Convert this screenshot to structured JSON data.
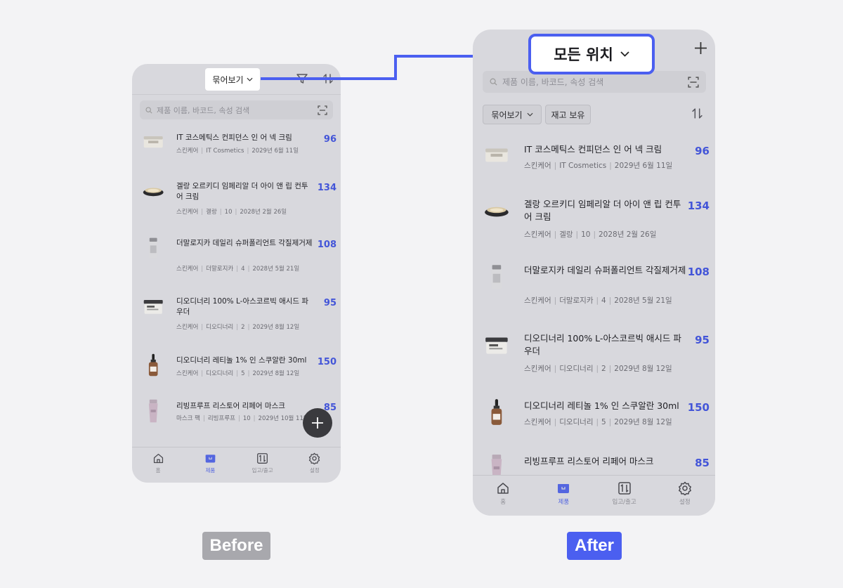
{
  "colors": {
    "accent": "#5466e0",
    "qty": "#4355d8",
    "phone_bg": "#d8d8dd",
    "page_bg": "#f3f3f5",
    "arrow": "#4b5ff0"
  },
  "before": {
    "caption": "Before",
    "group_view_label": "묶어보기",
    "search_placeholder": "제품 이름, 바코드, 속성 검색",
    "fab_icon": "plus-icon",
    "products": [
      {
        "name": "IT 코스메틱스 컨피던스 인 어 넥 크림",
        "meta": [
          "스킨케어",
          "IT Cosmetics",
          "2029년 6월 11일"
        ],
        "qty": "96",
        "thumb": "jar-white"
      },
      {
        "name": "겔랑 오르키디 임페리알 더 아이 앤 립 컨투어 크림",
        "meta": [
          "스킨케어",
          "겔랑",
          "10",
          "2028년 2월 26일"
        ],
        "qty": "134",
        "thumb": "jar-black"
      },
      {
        "name": "더말로지카 데일리 슈퍼폴리언트 각질제거제",
        "meta": [
          "스킨케어",
          "더말로지카",
          "4",
          "2028년 5월 21일"
        ],
        "qty": "108",
        "thumb": "bottle-silver"
      },
      {
        "name": "디오디너리 100% L-아스코르빅 애시드 파우더",
        "meta": [
          "스킨케어",
          "디오디너리",
          "2",
          "2029년 8월 12일"
        ],
        "qty": "95",
        "thumb": "jar-wide"
      },
      {
        "name": "디오디너리 레티놀 1% 인 스쿠알란 30ml",
        "meta": [
          "스킨케어",
          "디오디너리",
          "5",
          "2029년 8월 12일"
        ],
        "qty": "150",
        "thumb": "dropper"
      },
      {
        "name": "리빙프루프 리스토어 리페어 마스크",
        "meta": [
          "마스크 팩",
          "리빙프루프",
          "10",
          "2029년 10월 11일"
        ],
        "qty": "85",
        "thumb": "tube"
      }
    ],
    "tabs": [
      {
        "label": "홈",
        "icon": "home-icon"
      },
      {
        "label": "제품",
        "icon": "box-icon"
      },
      {
        "label": "입고/출고",
        "icon": "in-out-icon"
      },
      {
        "label": "설정",
        "icon": "gear-icon"
      }
    ]
  },
  "after": {
    "caption": "After",
    "location_label": "모든 위치",
    "search_placeholder": "제품 이름, 바코드, 속성 검색",
    "group_view_label": "묶어보기",
    "in_stock_label": "재고 보유",
    "products": [
      {
        "name": "IT 코스메틱스 컨피던스 인 어 넥 크림",
        "meta": [
          "스킨케어",
          "IT Cosmetics",
          "2029년 6월 11일"
        ],
        "qty": "96",
        "thumb": "jar-white"
      },
      {
        "name": "겔랑 오르키디 임페리알 더 아이 앤 립 컨투어 크림",
        "meta": [
          "스킨케어",
          "겔랑",
          "10",
          "2028년 2월 26일"
        ],
        "qty": "134",
        "thumb": "jar-black"
      },
      {
        "name": "더말로지카 데일리 슈퍼폴리언트 각질제거제",
        "meta": [
          "스킨케어",
          "더말로지카",
          "4",
          "2028년 5월 21일"
        ],
        "qty": "108",
        "thumb": "bottle-silver"
      },
      {
        "name": "디오디너리 100% L-아스코르빅 애시드 파우더",
        "meta": [
          "스킨케어",
          "디오디너리",
          "2",
          "2029년 8월 12일"
        ],
        "qty": "95",
        "thumb": "jar-wide"
      },
      {
        "name": "디오디너리 레티놀 1% 인 스쿠알란 30ml",
        "meta": [
          "스킨케어",
          "디오디너리",
          "5",
          "2029년 8월 12일"
        ],
        "qty": "150",
        "thumb": "dropper"
      },
      {
        "name": "리빙프루프 리스토어 리페어 마스크",
        "meta": [],
        "qty": "85",
        "thumb": "tube"
      }
    ],
    "tabs": [
      {
        "label": "홈",
        "icon": "home-icon"
      },
      {
        "label": "제품",
        "icon": "box-icon"
      },
      {
        "label": "입고/출고",
        "icon": "in-out-icon"
      },
      {
        "label": "설정",
        "icon": "gear-icon"
      }
    ]
  }
}
